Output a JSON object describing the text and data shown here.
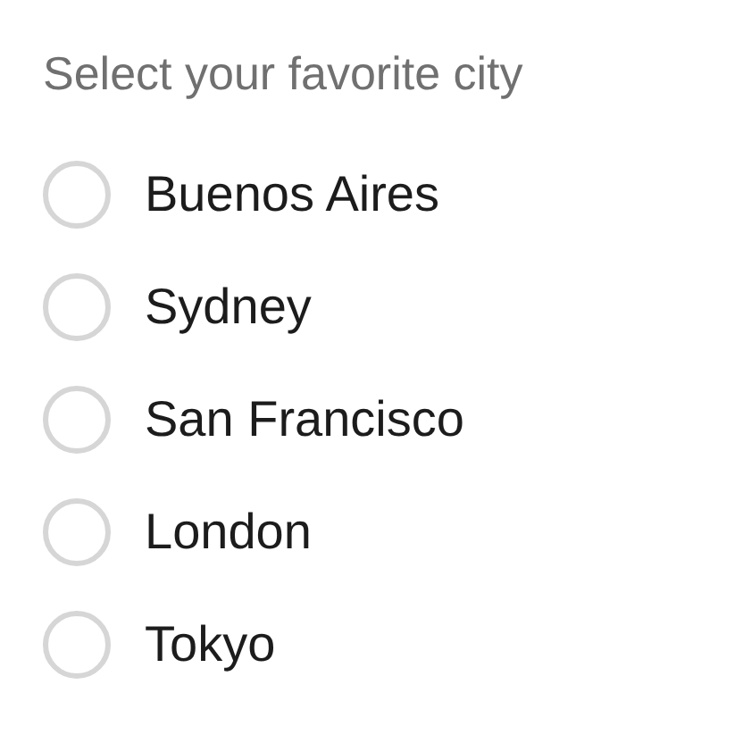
{
  "legend": "Select your favorite city",
  "options": [
    {
      "label": "Buenos Aires",
      "selected": false
    },
    {
      "label": "Sydney",
      "selected": false
    },
    {
      "label": "San Francisco",
      "selected": false
    },
    {
      "label": "London",
      "selected": false
    },
    {
      "label": "Tokyo",
      "selected": false
    }
  ]
}
